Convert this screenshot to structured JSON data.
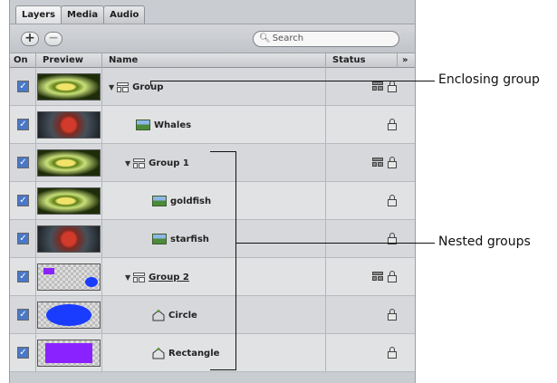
{
  "tabs": [
    {
      "label": "Layers",
      "active": true
    },
    {
      "label": "Media",
      "active": false
    },
    {
      "label": "Audio",
      "active": false
    }
  ],
  "toolbar": {
    "add_label": "+",
    "remove_label": "−",
    "search_placeholder": "Search",
    "search_icon": "magnifier-icon"
  },
  "columns": {
    "on": "On",
    "preview": "Preview",
    "name": "Name",
    "status": "Status",
    "more": "»"
  },
  "rows": [
    {
      "name": "Group",
      "type": "group",
      "indent": 0,
      "expanded": true,
      "checked": true,
      "thumb": "fish",
      "status_group": true
    },
    {
      "name": "Whales",
      "type": "image",
      "indent": 1,
      "checked": true,
      "thumb": "star",
      "status_group": false
    },
    {
      "name": "Group 1",
      "type": "group",
      "indent": 1,
      "expanded": true,
      "checked": true,
      "thumb": "fish",
      "status_group": true
    },
    {
      "name": "goldfish",
      "type": "image",
      "indent": 2,
      "checked": true,
      "thumb": "fish",
      "status_group": false
    },
    {
      "name": "starfish",
      "type": "image",
      "indent": 2,
      "checked": true,
      "thumb": "star",
      "status_group": false
    },
    {
      "name": "Group 2",
      "type": "group",
      "indent": 1,
      "expanded": true,
      "checked": true,
      "thumb": "blobs",
      "status_group": true,
      "underlined": true
    },
    {
      "name": "Circle",
      "type": "shape",
      "indent": 2,
      "checked": true,
      "thumb": "circle",
      "status_group": false
    },
    {
      "name": "Rectangle",
      "type": "shape",
      "indent": 2,
      "checked": true,
      "thumb": "rect",
      "status_group": false
    }
  ],
  "callouts": {
    "enclosing": "Enclosing group",
    "nested": "Nested groups"
  },
  "colors": {
    "checkbox": "#4a78c8",
    "shape_blue": "#1a3cff",
    "shape_purple": "#8a22ff"
  }
}
